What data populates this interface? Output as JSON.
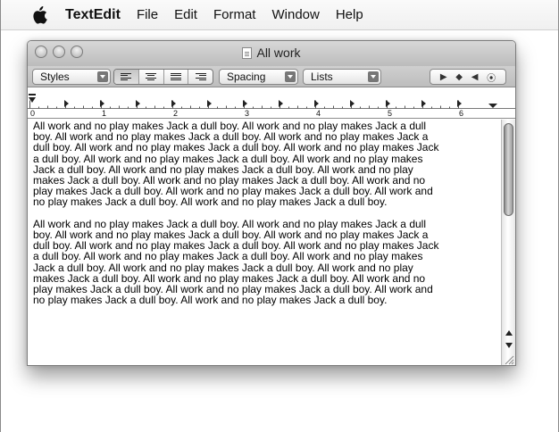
{
  "menubar": {
    "app": "TextEdit",
    "items": [
      "File",
      "Edit",
      "Format",
      "Window",
      "Help"
    ]
  },
  "window": {
    "title": "All work"
  },
  "toolbar": {
    "styles_label": "Styles",
    "spacing_label": "Spacing",
    "lists_label": "Lists"
  },
  "ruler": {
    "labels": [
      "0",
      "1",
      "2",
      "3",
      "4",
      "5",
      "6"
    ]
  },
  "document": {
    "lines": [
      "All work and no play makes Jack a dull boy. All work and no play makes Jack a dull",
      "boy. All work and no play makes Jack a dull boy. All work and no play makes Jack a",
      "dull boy. All work and no play makes Jack a dull boy. All work and no play makes Jack",
      "a dull boy. All work and no play makes Jack a dull boy. All work and no play makes",
      "Jack a dull boy. All work and no play makes Jack a dull boy. All work and no play",
      "makes Jack a dull boy. All work and no play makes Jack a dull boy. All work and no",
      "play makes Jack a dull boy. All work and no play makes Jack a dull boy. All work and",
      "no play makes Jack a dull boy. All work and no play makes Jack a dull boy."
    ],
    "lines2": [
      "All work and no play makes Jack a dull boy. All work and no play makes Jack a dull",
      "boy. All work and no play makes Jack a dull boy. All work and no play makes Jack a",
      "dull boy. All work and no play makes Jack a dull boy. All work and no play makes Jack",
      "a dull boy. All work and no play makes Jack a dull boy. All work and no play makes",
      "Jack a dull boy. All work and no play makes Jack a dull boy. All work and no play",
      "makes Jack a dull boy. All work and no play makes Jack a dull boy. All work and no",
      "play makes Jack a dull boy. All work and no play makes Jack a dull boy. All work and",
      "no play makes Jack a dull boy. All work and no play makes Jack a dull boy."
    ]
  },
  "icons": {
    "apple": "apple-icon",
    "document": "document-icon",
    "tab_left": "left-tab-icon",
    "tab_center": "center-tab-icon",
    "tab_right": "right-tab-icon",
    "tab_decimal": "decimal-tab-icon"
  }
}
